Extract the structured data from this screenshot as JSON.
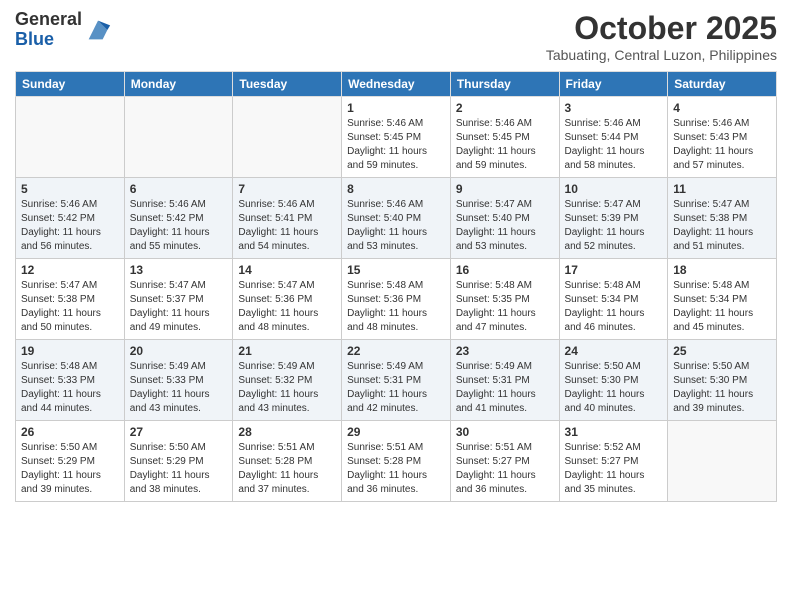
{
  "header": {
    "logo_general": "General",
    "logo_blue": "Blue",
    "month": "October 2025",
    "location": "Tabuating, Central Luzon, Philippines"
  },
  "weekdays": [
    "Sunday",
    "Monday",
    "Tuesday",
    "Wednesday",
    "Thursday",
    "Friday",
    "Saturday"
  ],
  "weeks": [
    [
      {
        "day": "",
        "info": ""
      },
      {
        "day": "",
        "info": ""
      },
      {
        "day": "",
        "info": ""
      },
      {
        "day": "1",
        "info": "Sunrise: 5:46 AM\nSunset: 5:45 PM\nDaylight: 11 hours\nand 59 minutes."
      },
      {
        "day": "2",
        "info": "Sunrise: 5:46 AM\nSunset: 5:45 PM\nDaylight: 11 hours\nand 59 minutes."
      },
      {
        "day": "3",
        "info": "Sunrise: 5:46 AM\nSunset: 5:44 PM\nDaylight: 11 hours\nand 58 minutes."
      },
      {
        "day": "4",
        "info": "Sunrise: 5:46 AM\nSunset: 5:43 PM\nDaylight: 11 hours\nand 57 minutes."
      }
    ],
    [
      {
        "day": "5",
        "info": "Sunrise: 5:46 AM\nSunset: 5:42 PM\nDaylight: 11 hours\nand 56 minutes."
      },
      {
        "day": "6",
        "info": "Sunrise: 5:46 AM\nSunset: 5:42 PM\nDaylight: 11 hours\nand 55 minutes."
      },
      {
        "day": "7",
        "info": "Sunrise: 5:46 AM\nSunset: 5:41 PM\nDaylight: 11 hours\nand 54 minutes."
      },
      {
        "day": "8",
        "info": "Sunrise: 5:46 AM\nSunset: 5:40 PM\nDaylight: 11 hours\nand 53 minutes."
      },
      {
        "day": "9",
        "info": "Sunrise: 5:47 AM\nSunset: 5:40 PM\nDaylight: 11 hours\nand 53 minutes."
      },
      {
        "day": "10",
        "info": "Sunrise: 5:47 AM\nSunset: 5:39 PM\nDaylight: 11 hours\nand 52 minutes."
      },
      {
        "day": "11",
        "info": "Sunrise: 5:47 AM\nSunset: 5:38 PM\nDaylight: 11 hours\nand 51 minutes."
      }
    ],
    [
      {
        "day": "12",
        "info": "Sunrise: 5:47 AM\nSunset: 5:38 PM\nDaylight: 11 hours\nand 50 minutes."
      },
      {
        "day": "13",
        "info": "Sunrise: 5:47 AM\nSunset: 5:37 PM\nDaylight: 11 hours\nand 49 minutes."
      },
      {
        "day": "14",
        "info": "Sunrise: 5:47 AM\nSunset: 5:36 PM\nDaylight: 11 hours\nand 48 minutes."
      },
      {
        "day": "15",
        "info": "Sunrise: 5:48 AM\nSunset: 5:36 PM\nDaylight: 11 hours\nand 48 minutes."
      },
      {
        "day": "16",
        "info": "Sunrise: 5:48 AM\nSunset: 5:35 PM\nDaylight: 11 hours\nand 47 minutes."
      },
      {
        "day": "17",
        "info": "Sunrise: 5:48 AM\nSunset: 5:34 PM\nDaylight: 11 hours\nand 46 minutes."
      },
      {
        "day": "18",
        "info": "Sunrise: 5:48 AM\nSunset: 5:34 PM\nDaylight: 11 hours\nand 45 minutes."
      }
    ],
    [
      {
        "day": "19",
        "info": "Sunrise: 5:48 AM\nSunset: 5:33 PM\nDaylight: 11 hours\nand 44 minutes."
      },
      {
        "day": "20",
        "info": "Sunrise: 5:49 AM\nSunset: 5:33 PM\nDaylight: 11 hours\nand 43 minutes."
      },
      {
        "day": "21",
        "info": "Sunrise: 5:49 AM\nSunset: 5:32 PM\nDaylight: 11 hours\nand 43 minutes."
      },
      {
        "day": "22",
        "info": "Sunrise: 5:49 AM\nSunset: 5:31 PM\nDaylight: 11 hours\nand 42 minutes."
      },
      {
        "day": "23",
        "info": "Sunrise: 5:49 AM\nSunset: 5:31 PM\nDaylight: 11 hours\nand 41 minutes."
      },
      {
        "day": "24",
        "info": "Sunrise: 5:50 AM\nSunset: 5:30 PM\nDaylight: 11 hours\nand 40 minutes."
      },
      {
        "day": "25",
        "info": "Sunrise: 5:50 AM\nSunset: 5:30 PM\nDaylight: 11 hours\nand 39 minutes."
      }
    ],
    [
      {
        "day": "26",
        "info": "Sunrise: 5:50 AM\nSunset: 5:29 PM\nDaylight: 11 hours\nand 39 minutes."
      },
      {
        "day": "27",
        "info": "Sunrise: 5:50 AM\nSunset: 5:29 PM\nDaylight: 11 hours\nand 38 minutes."
      },
      {
        "day": "28",
        "info": "Sunrise: 5:51 AM\nSunset: 5:28 PM\nDaylight: 11 hours\nand 37 minutes."
      },
      {
        "day": "29",
        "info": "Sunrise: 5:51 AM\nSunset: 5:28 PM\nDaylight: 11 hours\nand 36 minutes."
      },
      {
        "day": "30",
        "info": "Sunrise: 5:51 AM\nSunset: 5:27 PM\nDaylight: 11 hours\nand 36 minutes."
      },
      {
        "day": "31",
        "info": "Sunrise: 5:52 AM\nSunset: 5:27 PM\nDaylight: 11 hours\nand 35 minutes."
      },
      {
        "day": "",
        "info": ""
      }
    ]
  ]
}
